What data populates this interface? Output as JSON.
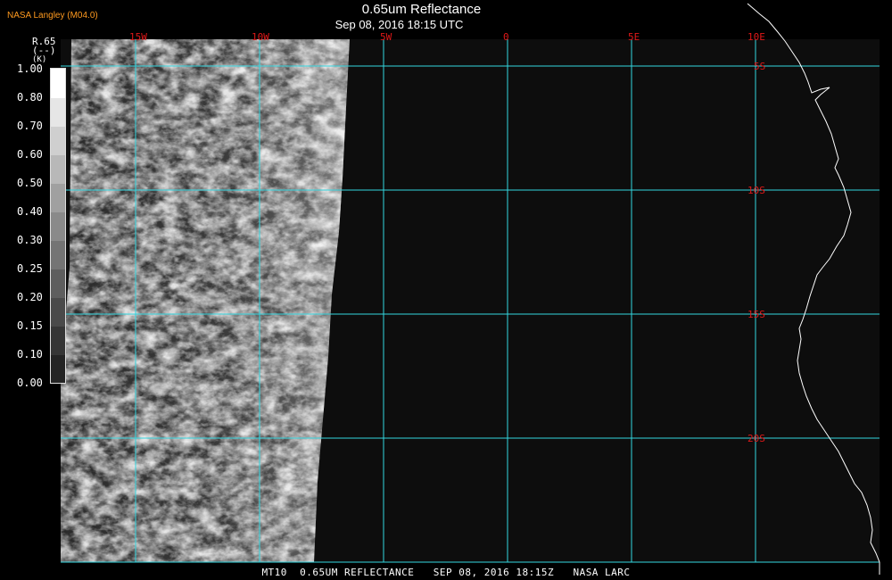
{
  "credit": "NASA Langley (M04.0)",
  "title": "0.65um Reflectance",
  "subtitle": "Sep 08, 2016 18:15 UTC",
  "legend": {
    "label_line1": "R.65",
    "label_line2": "(--)",
    "label_line3": "(K)",
    "ticks": [
      "1.00",
      "0.80",
      "0.70",
      "0.60",
      "0.50",
      "0.40",
      "0.30",
      "0.25",
      "0.20",
      "0.15",
      "0.10",
      "0.00"
    ]
  },
  "lon_labels": [
    "15W",
    "10W",
    "5W",
    "0",
    "5E",
    "10E"
  ],
  "lat_labels": [
    "5S",
    "10S",
    "15S",
    "20S"
  ],
  "footer": "MT10  0.65UM REFLECTANCE   SEP 08, 2016 18:15Z   NASA LARC",
  "colors": {
    "grid": "#33d6e0",
    "label_red": "#e01818",
    "credit": "#ff9a1f",
    "background": "#0d0d0d"
  }
}
